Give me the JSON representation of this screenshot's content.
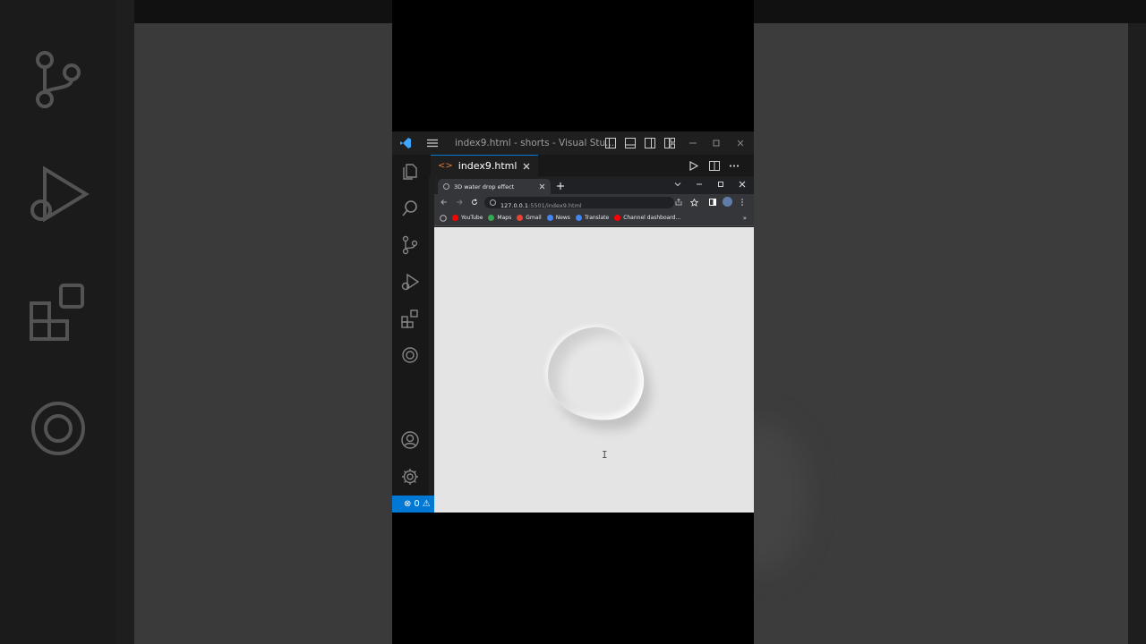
{
  "window": {
    "title": "index9.html - shorts - Visual Stu..."
  },
  "editor": {
    "active_tab": "index9.html"
  },
  "statusbar": {
    "problems_count": "0"
  },
  "browser": {
    "tab_title": "3D water drop effect",
    "url_host": "127.0.0.1",
    "url_path": ":5501/index9.html",
    "bookmarks": [
      {
        "label": "YouTube",
        "color": "#ff0000"
      },
      {
        "label": "Maps",
        "color": "#34a853"
      },
      {
        "label": "Gmail",
        "color": "#ea4335"
      },
      {
        "label": "News",
        "color": "#4285f4"
      },
      {
        "label": "Translate",
        "color": "#4285f4"
      },
      {
        "label": "Channel dashboard...",
        "color": "#ff0000"
      }
    ]
  },
  "colors": {
    "accent": "#0078d4",
    "page_bg": "#e4e4e4"
  }
}
